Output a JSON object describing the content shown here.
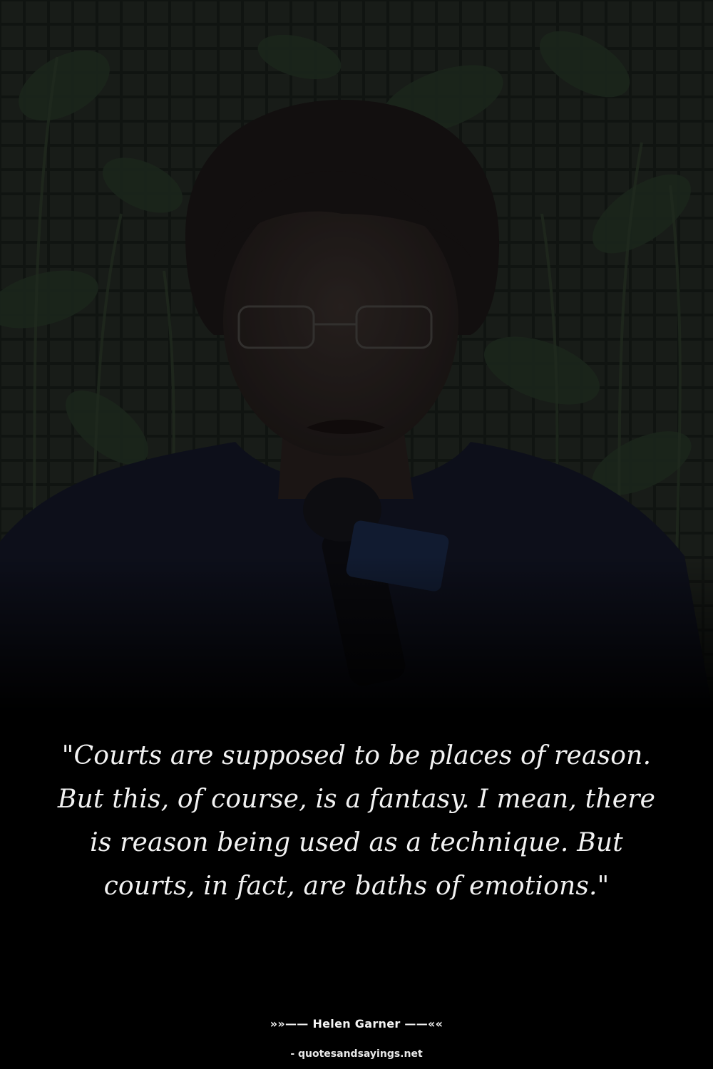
{
  "image": {
    "subject": "photo-woman-speaking-into-microphone"
  },
  "quote": {
    "text": "\"Courts are supposed to be places of reason. But this, of course, is a fantasy. I mean, there is reason being used as a technique. But courts, in fact, are baths of emotions.\""
  },
  "attribution": {
    "author_line": "»»—— Helen Garner ——««"
  },
  "footer": {
    "site": "- quotesandsayings.net"
  },
  "colors": {
    "background": "#000000",
    "text": "#f2f2f2",
    "foliage": "#2d3a2c",
    "jacket": "#14172b"
  }
}
